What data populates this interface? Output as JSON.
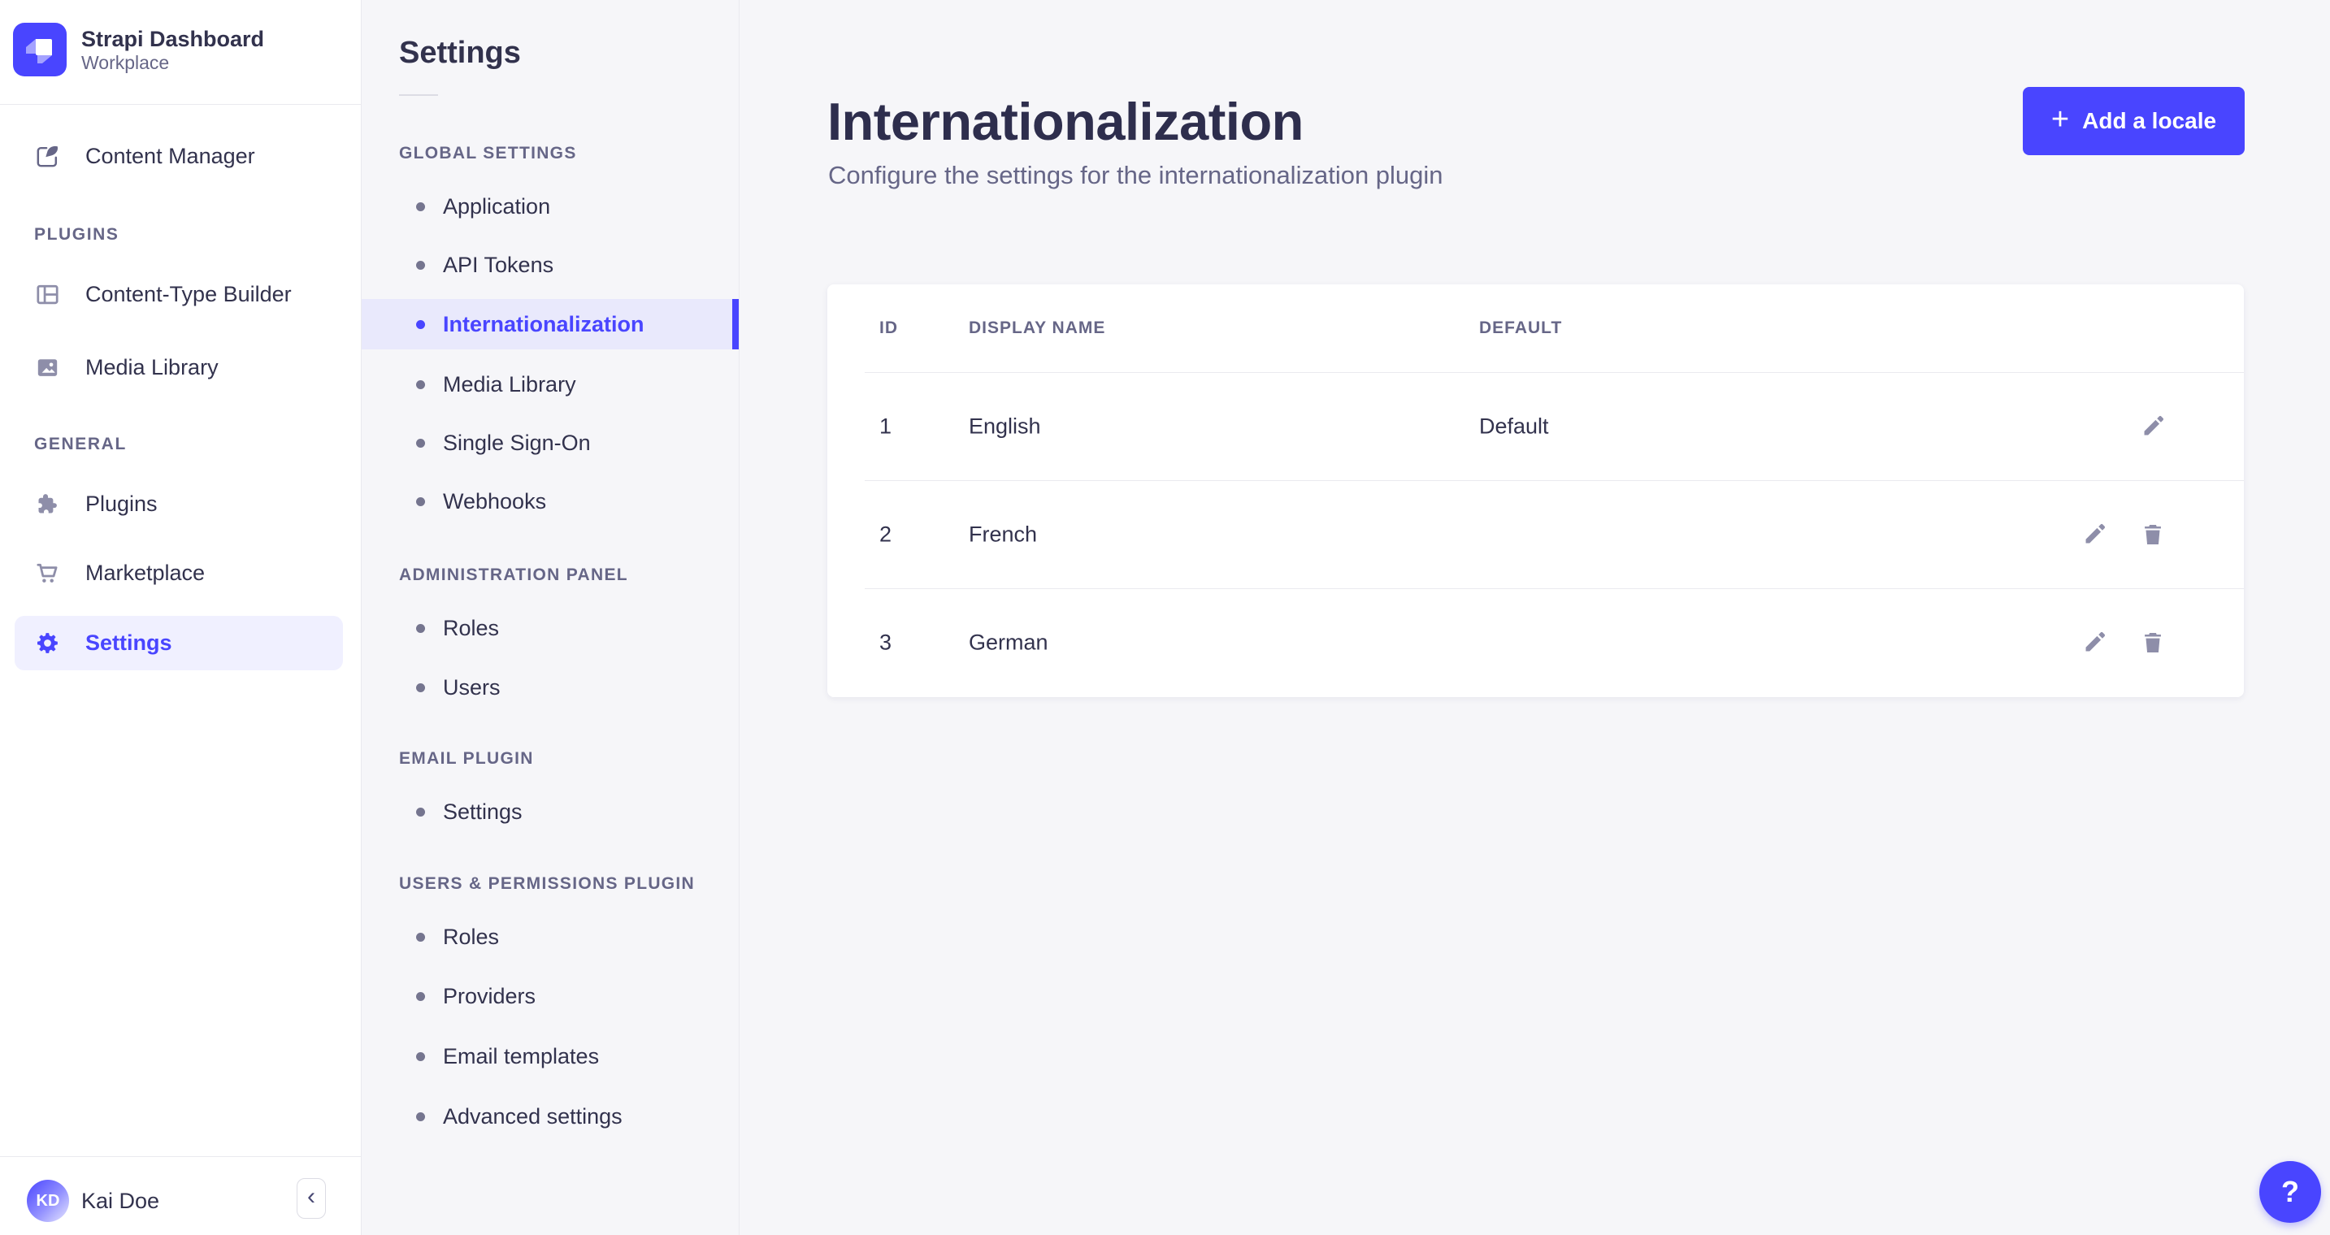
{
  "colors": {
    "primary": "#4945ff",
    "primary_active_bg": "#e9e9fc",
    "text_dark": "#32324d",
    "text_muted": "#666687",
    "icon_gray": "#8e8ea9",
    "border": "#eaeaef",
    "page_bg": "#f6f6f9"
  },
  "main_nav": {
    "brand": {
      "name": "Strapi Dashboard",
      "workspace": "Workplace"
    },
    "sections": {
      "plugins": "PLUGINS",
      "general": "GENERAL"
    },
    "items": {
      "content_manager": "Content Manager",
      "content_type_builder": "Content-Type Builder",
      "media_library": "Media Library",
      "plugins": "Plugins",
      "marketplace": "Marketplace",
      "settings": "Settings"
    },
    "user": {
      "name": "Kai Doe",
      "initials": "KD"
    },
    "collapse_glyph": "‹"
  },
  "settings_nav": {
    "title": "Settings",
    "sections": {
      "global": "GLOBAL SETTINGS",
      "admin": "ADMINISTRATION PANEL",
      "email": "EMAIL PLUGIN",
      "users_permissions": "USERS & PERMISSIONS PLUGIN"
    },
    "items": {
      "application": "Application",
      "api_tokens": "API Tokens",
      "internationalization": "Internationalization",
      "media_library": "Media Library",
      "sso": "Single Sign-On",
      "webhooks": "Webhooks",
      "admin_roles": "Roles",
      "admin_users": "Users",
      "email_settings": "Settings",
      "up_roles": "Roles",
      "up_providers": "Providers",
      "up_email_templates": "Email templates",
      "up_advanced": "Advanced settings"
    }
  },
  "page": {
    "title": "Internationalization",
    "subtitle": "Configure the settings for the internationalization plugin",
    "add_button_label": "Add a locale",
    "plus_glyph": "+",
    "help_glyph": "?"
  },
  "table": {
    "headers": {
      "id": "ID",
      "name": "DISPLAY NAME",
      "default": "DEFAULT"
    },
    "rows": [
      {
        "id": "1",
        "name": "English",
        "default": "Default"
      },
      {
        "id": "2",
        "name": "French",
        "default": ""
      },
      {
        "id": "3",
        "name": "German",
        "default": ""
      }
    ]
  }
}
